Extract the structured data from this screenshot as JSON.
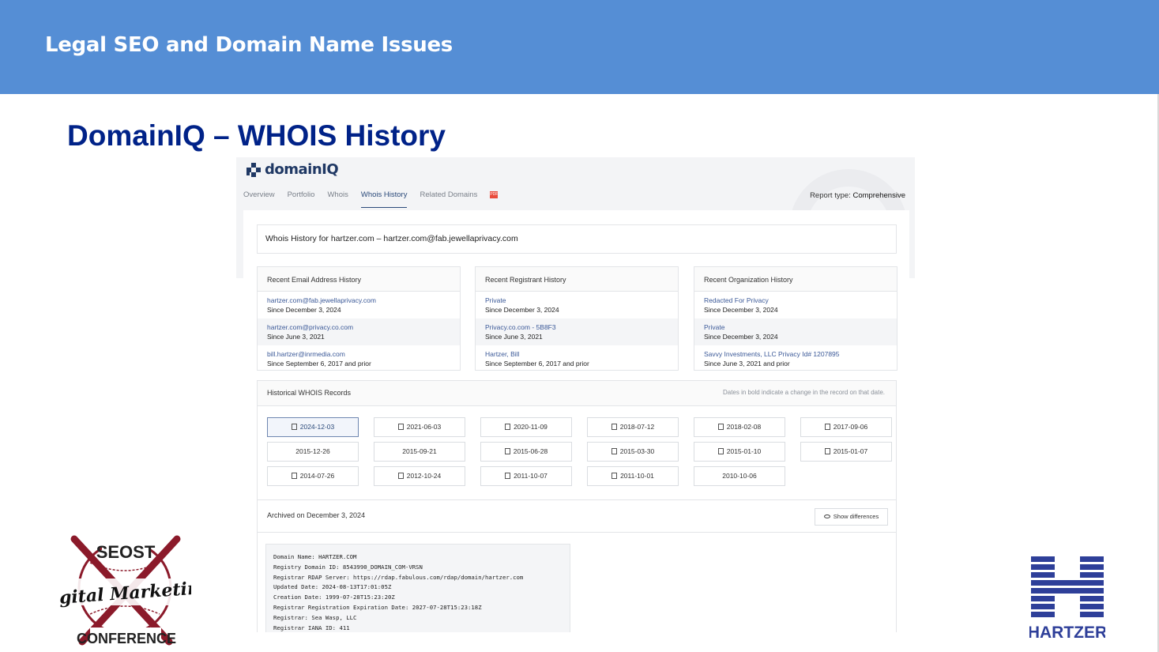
{
  "banner": {
    "title": "Legal SEO and Domain Name Issues"
  },
  "slide": {
    "title": "DomainIQ – WHOIS History"
  },
  "app": {
    "logo_text": "domainIQ",
    "tabs": [
      {
        "label": "Overview"
      },
      {
        "label": "Portfolio"
      },
      {
        "label": "Whois"
      },
      {
        "label": "Whois History",
        "active": true
      },
      {
        "label": "Related Domains"
      }
    ],
    "pdf_label": "PDF",
    "report_type_label": "Report type:",
    "report_type_value": "Comprehensive",
    "header": "Whois History for hartzer.com – hartzer.com@fab.jewellaprivacy.com",
    "email_history": {
      "title": "Recent Email Address History",
      "rows": [
        {
          "value": "hartzer.com@fab.jewellaprivacy.com",
          "since": "Since December 3, 2024"
        },
        {
          "value": "hartzer.com@privacy.co.com",
          "since": "Since June 3, 2021"
        },
        {
          "value": "bill.hartzer@inrmedia.com",
          "since": "Since September 6, 2017 and prior"
        }
      ]
    },
    "registrant_history": {
      "title": "Recent Registrant History",
      "rows": [
        {
          "value": "Private",
          "since": "Since December 3, 2024"
        },
        {
          "value": "Privacy.co.com - 5B8F3",
          "since": "Since June 3, 2021"
        },
        {
          "value": "Hartzer, Bill",
          "since": "Since September 6, 2017 and prior"
        }
      ]
    },
    "org_history": {
      "title": "Recent Organization History",
      "rows": [
        {
          "value": "Redacted For Privacy",
          "since": "Since December 3, 2024"
        },
        {
          "value": "Private",
          "since": "Since December 3, 2024"
        },
        {
          "value": "Savvy Investments, LLC Privacy Id# 1207895",
          "since": "Since June 3, 2021 and prior"
        }
      ]
    },
    "records": {
      "title": "Historical WHOIS Records",
      "note": "Dates in  bold indicate a change in the record on that date.",
      "dates": [
        {
          "label": "2024-12-03",
          "changed": true,
          "active": true
        },
        {
          "label": "2021-06-03",
          "changed": true
        },
        {
          "label": "2020-11-09",
          "changed": true
        },
        {
          "label": "2018-07-12",
          "changed": true
        },
        {
          "label": "2018-02-08",
          "changed": true
        },
        {
          "label": "2017-09-06",
          "changed": true
        },
        {
          "label": "2015-12-26",
          "changed": false
        },
        {
          "label": "2015-09-21",
          "changed": false
        },
        {
          "label": "2015-06-28",
          "changed": true
        },
        {
          "label": "2015-03-30",
          "changed": true
        },
        {
          "label": "2015-01-10",
          "changed": true
        },
        {
          "label": "2015-01-07",
          "changed": true
        },
        {
          "label": "2014-07-26",
          "changed": true
        },
        {
          "label": "2012-10-24",
          "changed": true
        },
        {
          "label": "2011-10-07",
          "changed": true
        },
        {
          "label": "2011-10-01",
          "changed": true
        },
        {
          "label": "2010-10-06",
          "changed": false
        }
      ],
      "archived": "Archived on December 3, 2024",
      "show_diff": "Show differences",
      "raw": "Domain Name: HARTZER.COM\nRegistry Domain ID: 8543990_DOMAIN_COM-VRSN\nRegistrar RDAP Server: https://rdap.fabulous.com/rdap/domain/hartzer.com\nUpdated Date: 2024-08-13T17:01:05Z\nCreation Date: 1999-07-28T15:23:20Z\nRegistrar Registration Expiration Date: 2027-07-28T15:23:18Z\nRegistrar: Sea Wasp, LLC\nRegistrar IANA ID: 411"
    }
  },
  "logos": {
    "seost_top": "SEOST",
    "seost_mid": "Digital Marketing",
    "seost_bottom": "CONFERENCE",
    "hartzer": "HARTZER"
  },
  "colors": {
    "banner": "#558ed5",
    "title": "#002288",
    "hartzer": "#2e3f99",
    "seost_red": "#8b1a2a"
  }
}
